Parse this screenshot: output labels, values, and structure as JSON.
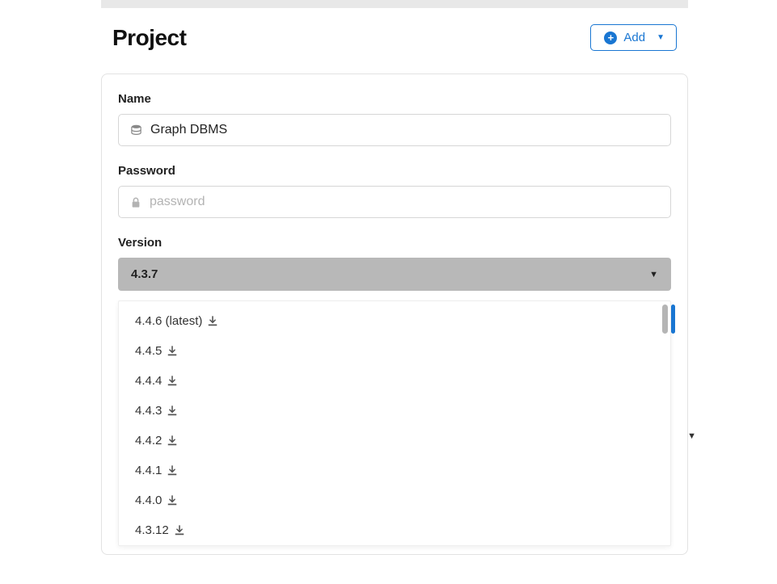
{
  "header": {
    "title": "Project",
    "add_label": "Add"
  },
  "form": {
    "name_label": "Name",
    "name_value": "Graph DBMS",
    "password_label": "Password",
    "password_placeholder": "password",
    "version_label": "Version",
    "version_selected": "4.3.7"
  },
  "version_options": [
    {
      "label": "4.4.6 (latest)"
    },
    {
      "label": "4.4.5"
    },
    {
      "label": "4.4.4"
    },
    {
      "label": "4.4.3"
    },
    {
      "label": "4.4.2"
    },
    {
      "label": "4.4.1"
    },
    {
      "label": "4.4.0"
    },
    {
      "label": "4.3.12"
    }
  ]
}
